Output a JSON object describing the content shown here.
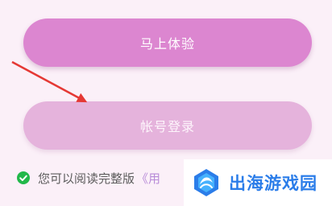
{
  "buttons": {
    "primary_label": "马上体验",
    "secondary_label": "帐号登录"
  },
  "agreement": {
    "text": "您可以阅读完整版",
    "link_text": "《用"
  },
  "watermark": {
    "text": "出海游戏园"
  },
  "icons": {
    "check": "check-circle-icon",
    "arrow": "arrow-annotation",
    "logo": "watermark-logo-icon"
  },
  "colors": {
    "primary": "#dc86d0",
    "secondary": "#e5b3dc",
    "arrow": "#e53935",
    "check": "#22b84a",
    "link": "#b88bd8",
    "watermark": "#2b7de9"
  }
}
